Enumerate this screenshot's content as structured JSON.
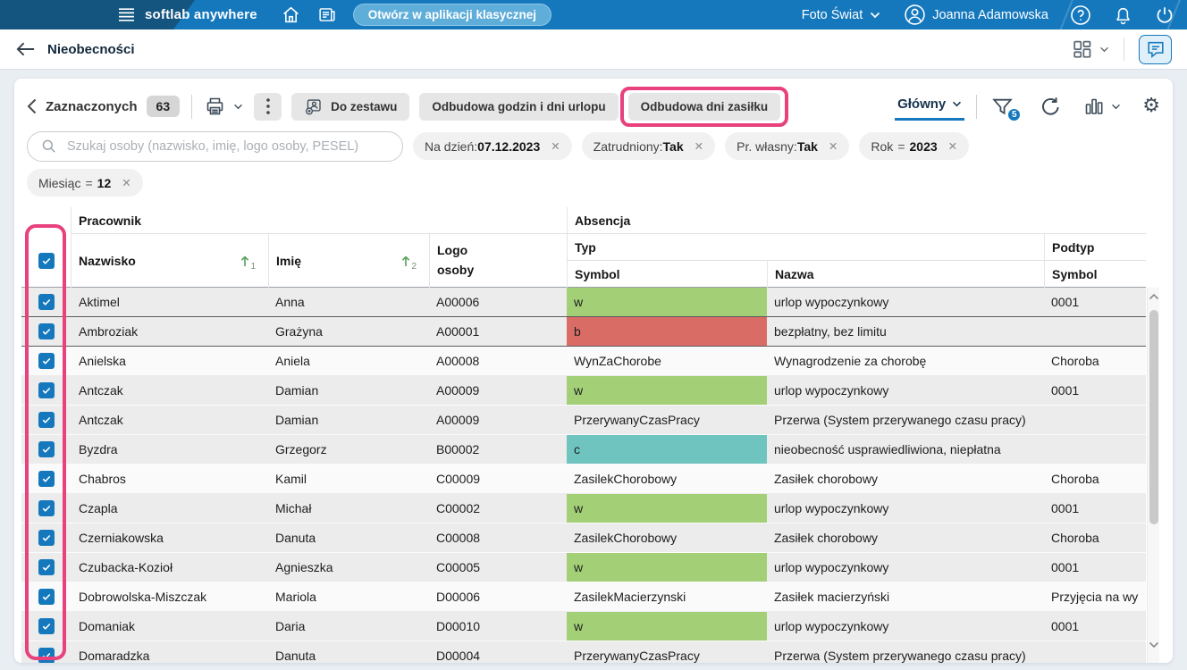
{
  "topbar": {
    "brand": "softlab anywhere",
    "open_classic_button": "Otwórz w aplikacji klasycznej",
    "company": "Foto Świat",
    "user_name": "Joanna Adamowska"
  },
  "header": {
    "title": "Nieobecności"
  },
  "toolbar": {
    "selected_label": "Zaznaczonych",
    "selected_count": "63",
    "add_to_set_button": "Do zestawu",
    "rebuild_hours_button": "Odbudowa godzin i dni urlopu",
    "rebuild_benefit_days_button": "Odbudowa dni zasiłku",
    "view_name": "Główny",
    "filter_badge_count": "5"
  },
  "filters": {
    "search_placeholder": "Szukaj osoby (nazwisko, imię, logo osoby, PESEL)",
    "chips_row1": [
      {
        "label": "Na dzień:",
        "value": "07.12.2023",
        "close": "✕"
      },
      {
        "label": "Zatrudniony:",
        "value": "Tak",
        "close": "✕"
      },
      {
        "label": "Pr. własny:",
        "value": "Tak",
        "close": "✕"
      },
      {
        "label": "Rok",
        "op": "=",
        "value": "2023",
        "close": "✕"
      }
    ],
    "chips_row2": [
      {
        "label": "Miesiąc",
        "op": "=",
        "value": "12",
        "close": "✕"
      }
    ]
  },
  "table": {
    "group_headers": {
      "pracownik": "Pracownik",
      "absencja": "Absencja"
    },
    "columns": {
      "nazwisko": "Nazwisko",
      "imie": "Imię",
      "logo_line1": "Logo",
      "logo_line2": "osoby",
      "typ": "Typ",
      "podtyp": "Podtyp",
      "typ_symbol": "Symbol",
      "typ_nazwa": "Nazwa",
      "podtyp_symbol": "Symbol"
    },
    "sort_indicators": {
      "nazwisko": "1",
      "imie": "2"
    },
    "rows": [
      {
        "nazwisko": "Aktimel",
        "imie": "Anna",
        "logo": "A00006",
        "symbol": "w",
        "symbol_color": "green",
        "nazwa": "urlop wypoczynkowy",
        "podtyp": "0001"
      },
      {
        "nazwisko": "Ambroziak",
        "imie": "Grażyna",
        "logo": "A00001",
        "symbol": "b",
        "symbol_color": "red",
        "nazwa": "bezpłatny, bez limitu",
        "podtyp": ""
      },
      {
        "nazwisko": "Anielska",
        "imie": "Aniela",
        "logo": "A00008",
        "symbol": "WynZaChorobe",
        "symbol_color": "",
        "nazwa": "Wynagrodzenie za chorobę",
        "podtyp": "Choroba"
      },
      {
        "nazwisko": "Antczak",
        "imie": "Damian",
        "logo": "A00009",
        "symbol": "w",
        "symbol_color": "green",
        "nazwa": "urlop wypoczynkowy",
        "podtyp": "0001"
      },
      {
        "nazwisko": "Antczak",
        "imie": "Damian",
        "logo": "A00009",
        "symbol": "PrzerywanyCzasPracy",
        "symbol_color": "",
        "nazwa": "Przerwa (System przerywanego czasu pracy)",
        "podtyp": ""
      },
      {
        "nazwisko": "Byzdra",
        "imie": "Grzegorz",
        "logo": "B00002",
        "symbol": "c",
        "symbol_color": "teal",
        "nazwa": "nieobecność usprawiedliwiona, niepłatna",
        "podtyp": ""
      },
      {
        "nazwisko": "Chabros",
        "imie": "Kamil",
        "logo": "C00009",
        "symbol": "ZasilekChorobowy",
        "symbol_color": "",
        "nazwa": "Zasiłek chorobowy",
        "podtyp": "Choroba"
      },
      {
        "nazwisko": "Czapla",
        "imie": "Michał",
        "logo": "C00002",
        "symbol": "w",
        "symbol_color": "green",
        "nazwa": "urlop wypoczynkowy",
        "podtyp": "0001"
      },
      {
        "nazwisko": "Czerniakowska",
        "imie": "Danuta",
        "logo": "C00008",
        "symbol": "ZasilekChorobowy",
        "symbol_color": "",
        "nazwa": "Zasiłek chorobowy",
        "podtyp": "Choroba"
      },
      {
        "nazwisko": "Czubacka-Kozioł",
        "imie": "Agnieszka",
        "logo": "C00005",
        "symbol": "w",
        "symbol_color": "green",
        "nazwa": "urlop wypoczynkowy",
        "podtyp": "0001"
      },
      {
        "nazwisko": "Dobrowolska-Miszczak",
        "imie": "Mariola",
        "logo": "D00006",
        "symbol": "ZasilekMacierzynski",
        "symbol_color": "",
        "nazwa": "Zasiłek macierzyński",
        "podtyp": "Przyjęcia na wy"
      },
      {
        "nazwisko": "Domaniak",
        "imie": "Daria",
        "logo": "D00010",
        "symbol": "w",
        "symbol_color": "green",
        "nazwa": "urlop wypoczynkowy",
        "podtyp": "0001"
      },
      {
        "nazwisko": "Domaradzka",
        "imie": "Danuta",
        "logo": "D00004",
        "symbol": "PrzerywanyCzasPracy",
        "symbol_color": "",
        "nazwa": "Przerwa (System przerywanego czasu pracy)",
        "podtyp": ""
      }
    ]
  },
  "icons": {
    "gear": "⚙"
  },
  "colors": {
    "topbar_blue": "#1578bd",
    "topbar_dark_corner": "#14557f",
    "accent_blue": "#1578bd",
    "annotation_pink": "#e8417e",
    "symbol_green": "#a3d077",
    "symbol_red": "#da6c66",
    "symbol_teal": "#70c4c0"
  }
}
